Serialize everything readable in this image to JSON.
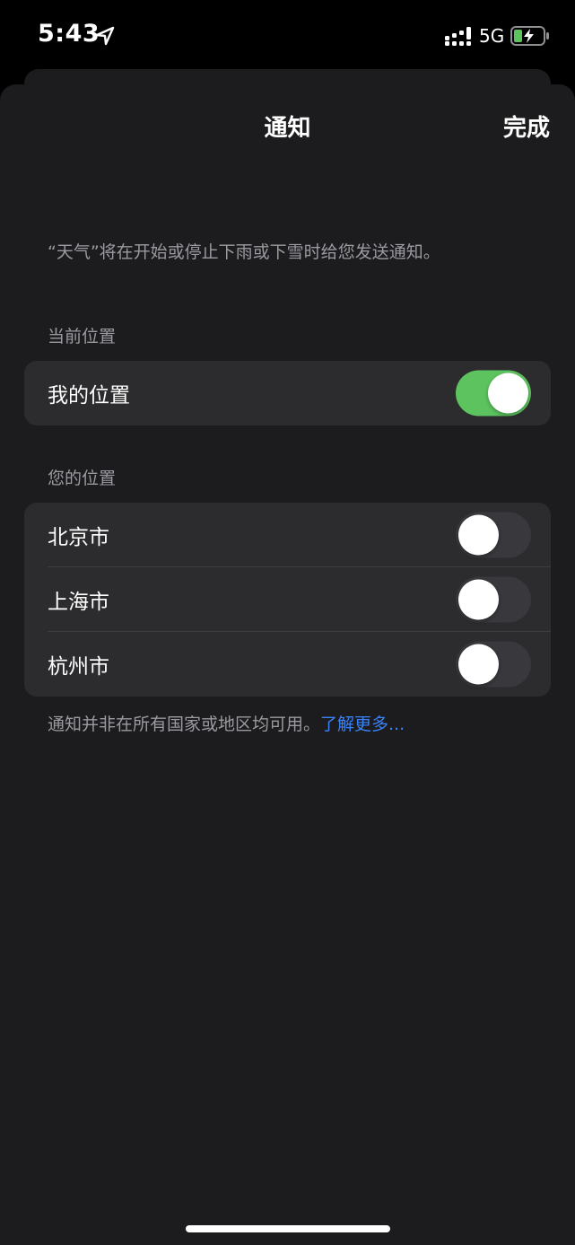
{
  "status_bar": {
    "time": "5:43",
    "network": "5G",
    "battery_color": "#5cc35f"
  },
  "nav": {
    "title": "通知",
    "done_label": "完成"
  },
  "description": "“天气”将在开始或停止下雨或下雪时给您发送通知。",
  "current_location_section": {
    "header": "当前位置",
    "rows": [
      {
        "label": "我的位置",
        "enabled": true
      }
    ]
  },
  "your_locations_section": {
    "header": "您的位置",
    "rows": [
      {
        "label": "北京市",
        "enabled": false
      },
      {
        "label": "上海市",
        "enabled": false
      },
      {
        "label": "杭州市",
        "enabled": false
      }
    ]
  },
  "footer": {
    "note": "通知并非在所有国家或地区均可用。",
    "link_label": "了解更多..."
  },
  "colors": {
    "toggle_on": "#5cc35f",
    "link": "#3b82f6",
    "background": "#1c1c1e",
    "group_background": "#2c2c2e"
  }
}
